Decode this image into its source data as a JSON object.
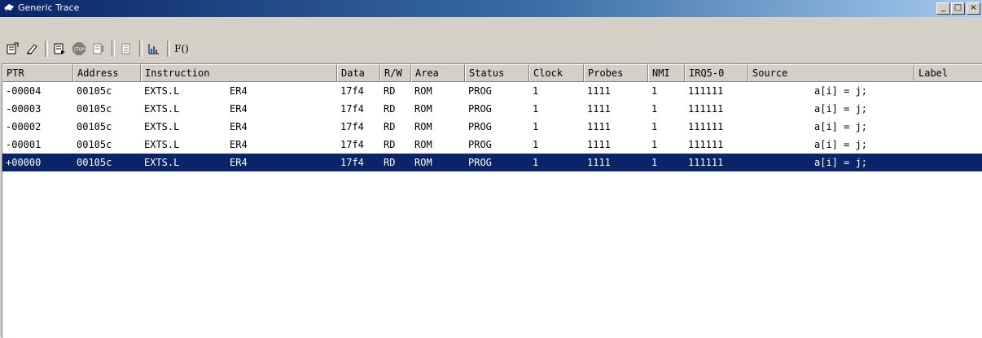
{
  "window": {
    "title": "Generic Trace"
  },
  "window_buttons": {
    "minimize": "_",
    "maximize": "□",
    "close": "×"
  },
  "toolbar": {
    "function_label": "F()"
  },
  "columns": [
    "PTR",
    "Address",
    "Instruction",
    "Data",
    "R/W",
    "Area",
    "Status",
    "Clock",
    "Probes",
    "NMI",
    "IRQ5-0",
    "Source",
    "Label"
  ],
  "rows": [
    {
      "ptr": "-00004",
      "address": "00105c",
      "mnemonic": "EXTS.L",
      "operand": "ER4",
      "data": "17f4",
      "rw": "RD",
      "area": "ROM",
      "status": "PROG",
      "clock": "1",
      "probes": "1111",
      "nmi": "1",
      "irq": "111111",
      "source": "a[i] = j;",
      "label": ""
    },
    {
      "ptr": "-00003",
      "address": "00105c",
      "mnemonic": "EXTS.L",
      "operand": "ER4",
      "data": "17f4",
      "rw": "RD",
      "area": "ROM",
      "status": "PROG",
      "clock": "1",
      "probes": "1111",
      "nmi": "1",
      "irq": "111111",
      "source": "a[i] = j;",
      "label": ""
    },
    {
      "ptr": "-00002",
      "address": "00105c",
      "mnemonic": "EXTS.L",
      "operand": "ER4",
      "data": "17f4",
      "rw": "RD",
      "area": "ROM",
      "status": "PROG",
      "clock": "1",
      "probes": "1111",
      "nmi": "1",
      "irq": "111111",
      "source": "a[i] = j;",
      "label": ""
    },
    {
      "ptr": "-00001",
      "address": "00105c",
      "mnemonic": "EXTS.L",
      "operand": "ER4",
      "data": "17f4",
      "rw": "RD",
      "area": "ROM",
      "status": "PROG",
      "clock": "1",
      "probes": "1111",
      "nmi": "1",
      "irq": "111111",
      "source": "a[i] = j;",
      "label": ""
    },
    {
      "ptr": "+00000",
      "address": "00105c",
      "mnemonic": "EXTS.L",
      "operand": "ER4",
      "data": "17f4",
      "rw": "RD",
      "area": "ROM",
      "status": "PROG",
      "clock": "1",
      "probes": "1111",
      "nmi": "1",
      "irq": "111111",
      "source": "a[i] = j;",
      "label": "",
      "selected": true
    }
  ],
  "colors": {
    "selection": "#0a246a",
    "title_start": "#0a246a",
    "title_end": "#a6caf0",
    "face": "#d4d0c8"
  }
}
